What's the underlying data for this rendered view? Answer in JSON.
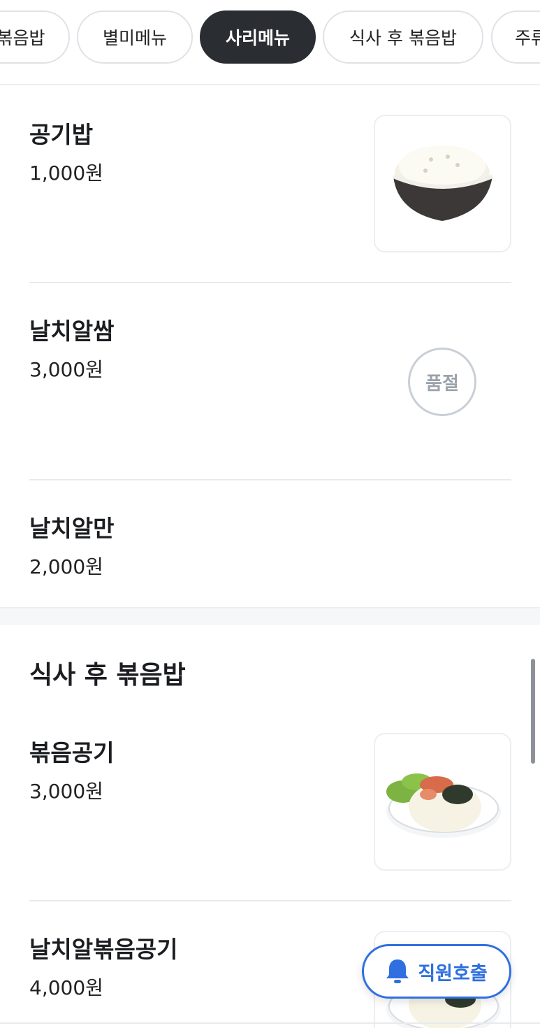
{
  "tabs": [
    {
      "label": "볶음밥",
      "active": false
    },
    {
      "label": "별미메뉴",
      "active": false
    },
    {
      "label": "사리메뉴",
      "active": true
    },
    {
      "label": "식사 후 볶음밥",
      "active": false
    },
    {
      "label": "주류",
      "active": false
    }
  ],
  "items": [
    {
      "name": "공기밥",
      "price": "1,000원",
      "image": "rice-bowl"
    },
    {
      "name": "날치알쌈",
      "price": "3,000원",
      "soldout_label": "품절"
    },
    {
      "name": "날치알만",
      "price": "2,000원"
    }
  ],
  "section": {
    "title": "식사 후 볶음밥",
    "items": [
      {
        "name": "볶음공기",
        "price": "3,000원",
        "image": "fried-rice-plate"
      },
      {
        "name": "날치알볶음공기",
        "price": "4,000원",
        "image": "fried-rice-plate"
      }
    ]
  },
  "call_button": {
    "label": "직원호출",
    "icon": "bell-icon"
  },
  "colors": {
    "accent": "#2f6fe0",
    "active_tab": "#2a2d32",
    "soldout": "#9aa2ab"
  }
}
